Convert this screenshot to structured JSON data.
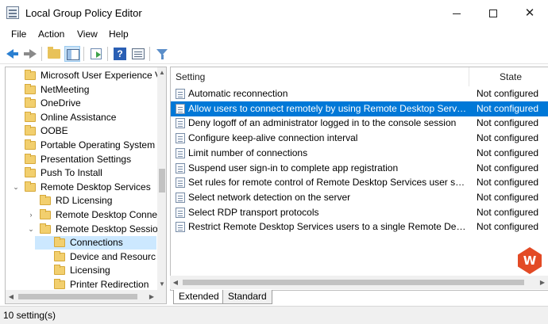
{
  "window": {
    "title": "Local Group Policy Editor",
    "minimize_glyph": "",
    "maximize_glyph": "",
    "close_glyph": "✕"
  },
  "menu": [
    "File",
    "Action",
    "View",
    "Help"
  ],
  "toolbar": {
    "icons": [
      "back-icon",
      "forward-icon",
      "up-folder-icon",
      "show-hide-tree-icon",
      "export-list-icon",
      "help-icon",
      "properties-icon",
      "filter-icon"
    ]
  },
  "tree": {
    "items": [
      {
        "label": "Microsoft User Experience V",
        "twisty": "",
        "indent": 0
      },
      {
        "label": "NetMeeting",
        "twisty": "",
        "indent": 0
      },
      {
        "label": "OneDrive",
        "twisty": "",
        "indent": 0
      },
      {
        "label": "Online Assistance",
        "twisty": "",
        "indent": 0
      },
      {
        "label": "OOBE",
        "twisty": "",
        "indent": 0
      },
      {
        "label": "Portable Operating System",
        "twisty": "",
        "indent": 0
      },
      {
        "label": "Presentation Settings",
        "twisty": "",
        "indent": 0
      },
      {
        "label": "Push To Install",
        "twisty": "",
        "indent": 0
      },
      {
        "label": "Remote Desktop Services",
        "twisty": "⌄",
        "indent": 0
      },
      {
        "label": "RD Licensing",
        "twisty": "",
        "indent": 1
      },
      {
        "label": "Remote Desktop Conne",
        "twisty": "›",
        "indent": 1
      },
      {
        "label": "Remote Desktop Sessio",
        "twisty": "⌄",
        "indent": 1
      },
      {
        "label": "Connections",
        "twisty": "",
        "indent": 2,
        "selected": true
      },
      {
        "label": "Device and Resourc",
        "twisty": "",
        "indent": 2
      },
      {
        "label": "Licensing",
        "twisty": "",
        "indent": 2
      },
      {
        "label": "Printer Redirection",
        "twisty": "",
        "indent": 2
      }
    ]
  },
  "list": {
    "columns": {
      "setting": "Setting",
      "state": "State"
    },
    "rows": [
      {
        "name": "Automatic reconnection",
        "state": "Not configured"
      },
      {
        "name": "Allow users to connect remotely by using Remote Desktop Services",
        "state": "Not configured",
        "selected": true
      },
      {
        "name": "Deny logoff of an administrator logged in to the console session",
        "state": "Not configured"
      },
      {
        "name": "Configure keep-alive connection interval",
        "state": "Not configured"
      },
      {
        "name": "Limit number of connections",
        "state": "Not configured"
      },
      {
        "name": "Suspend user sign-in to complete app registration",
        "state": "Not configured"
      },
      {
        "name": "Set rules for remote control of Remote Desktop Services user sessi...",
        "state": "Not configured"
      },
      {
        "name": "Select network detection on the server",
        "state": "Not configured"
      },
      {
        "name": "Select RDP transport protocols",
        "state": "Not configured"
      },
      {
        "name": "Restrict Remote Desktop Services users to a single Remote Desktop...",
        "state": "Not configured"
      }
    ]
  },
  "tabs": [
    "Extended",
    "Standard"
  ],
  "status": "10 setting(s)",
  "scroll_glyphs": {
    "up": "▲",
    "down": "▼",
    "left": "◀",
    "right": "▶"
  },
  "brand_letter": "W",
  "colors": {
    "selection": "#0078d7",
    "tree_selection": "#cce8ff",
    "folder": "#f2cf6e"
  }
}
